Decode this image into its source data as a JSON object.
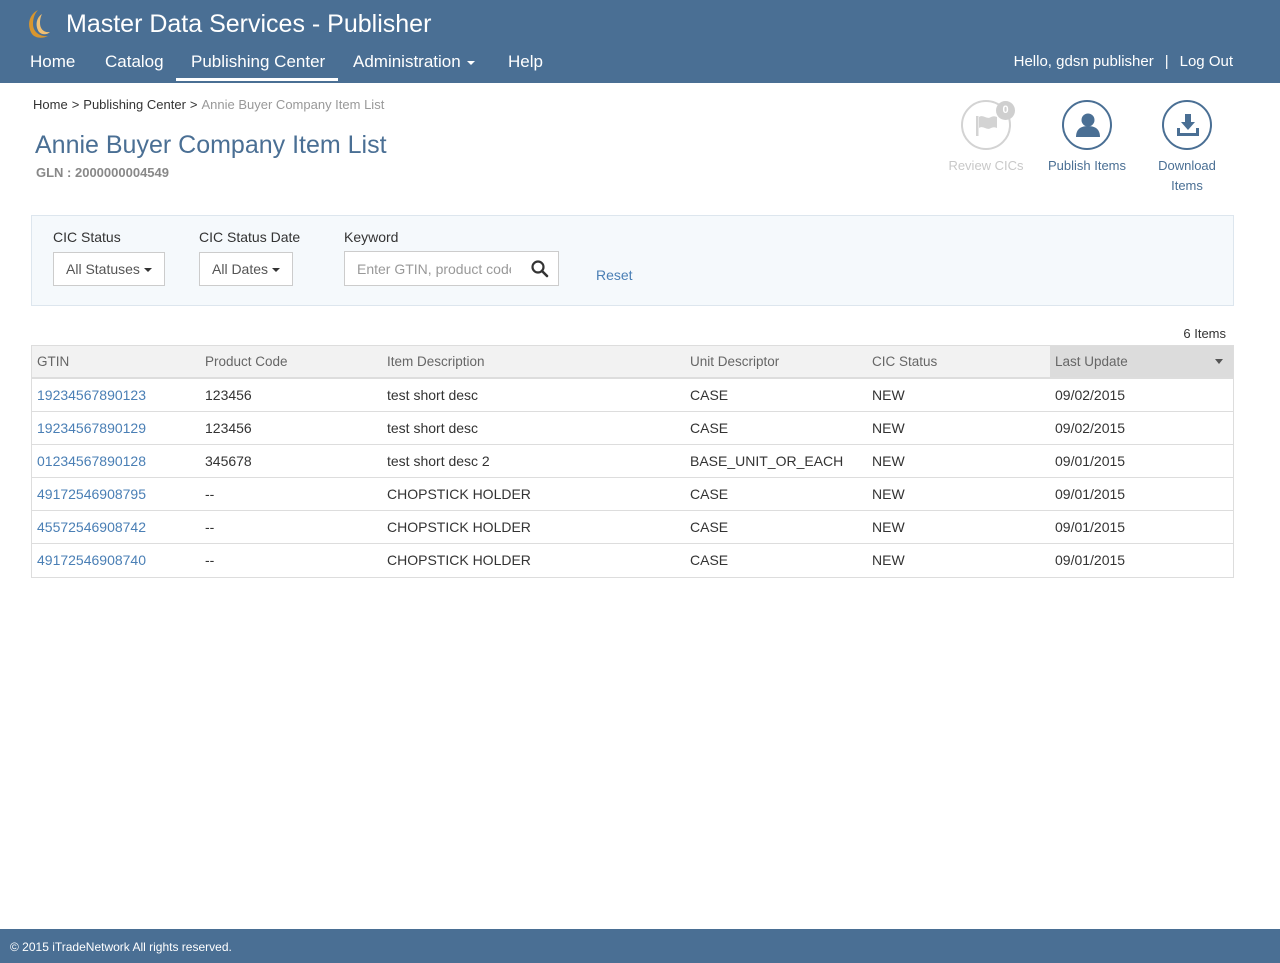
{
  "header": {
    "app_title": "Master Data Services - Publisher",
    "logo_icon": "swirl-logo-icon",
    "nav": [
      {
        "label": "Home"
      },
      {
        "label": "Catalog"
      },
      {
        "label": "Publishing Center",
        "active": true
      },
      {
        "label": "Administration",
        "has_dropdown": true
      },
      {
        "label": "Help"
      }
    ],
    "greeting": "Hello, gdsn publisher",
    "separator": "|",
    "logout_label": "Log Out"
  },
  "breadcrumb": {
    "items": [
      "Home",
      "Publishing Center"
    ],
    "separator": ">",
    "current": "Annie Buyer Company Item List"
  },
  "page": {
    "title": "Annie Buyer Company Item List",
    "gln": "GLN : 2000000004549"
  },
  "actions": {
    "review": {
      "label": "Review CICs",
      "badge": "0",
      "icon": "flag-icon",
      "enabled": false
    },
    "publish": {
      "label": "Publish Items",
      "icon": "person-icon",
      "enabled": true
    },
    "download": {
      "label1": "Download",
      "label2": "Items",
      "icon": "download-icon",
      "enabled": true
    }
  },
  "filters": {
    "cic_status_label": "CIC Status",
    "cic_status_value": "All Statuses",
    "cic_date_label": "CIC Status Date",
    "cic_date_value": "All Dates",
    "keyword_label": "Keyword",
    "keyword_placeholder": "Enter GTIN, product code",
    "keyword_value": "",
    "reset_label": "Reset"
  },
  "table": {
    "count_label": "6 Items",
    "columns": [
      "GTIN",
      "Product Code",
      "Item Description",
      "Unit Descriptor",
      "CIC Status",
      "Last Update"
    ],
    "sorted_column": "Last Update",
    "sort_direction": "descending",
    "rows": [
      [
        "19234567890123",
        "123456",
        "test short desc",
        "CASE",
        "NEW",
        "09/02/2015"
      ],
      [
        "19234567890129",
        "123456",
        "test short desc",
        "CASE",
        "NEW",
        "09/02/2015"
      ],
      [
        "01234567890128",
        "345678",
        "test short desc 2",
        "BASE_UNIT_OR_EACH",
        "NEW",
        "09/01/2015"
      ],
      [
        "49172546908795",
        "--",
        "CHOPSTICK HOLDER",
        "CASE",
        "NEW",
        "09/01/2015"
      ],
      [
        "45572546908742",
        "--",
        "CHOPSTICK HOLDER",
        "CASE",
        "NEW",
        "09/01/2015"
      ],
      [
        "49172546908740",
        "--",
        "CHOPSTICK HOLDER",
        "CASE",
        "NEW",
        "09/01/2015"
      ]
    ]
  },
  "footer": {
    "text": "© 2015 iTradeNetwork All rights reserved."
  },
  "colors": {
    "brand": "#4a6f94",
    "link": "#4a7fb5",
    "logo_accent": "#d9962e"
  }
}
